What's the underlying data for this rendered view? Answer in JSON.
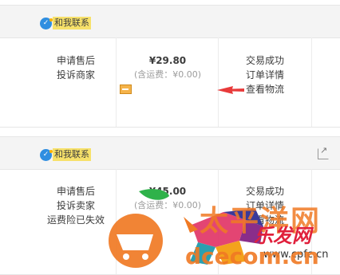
{
  "orders": [
    {
      "contact_label": "和我联系",
      "service": [
        "申请售后",
        "投诉商家"
      ],
      "price": "¥29.80",
      "shipping": "(含运费：¥0.00)",
      "status": [
        "交易成功",
        "订单详情",
        "查看物流"
      ]
    },
    {
      "contact_label": "和我联系",
      "service": [
        "申请售后",
        "投诉卖家",
        "运费险已失效"
      ],
      "price": "¥45.00",
      "shipping": "(含运费：¥0.00)",
      "status": [
        "交易成功",
        "订单详情",
        "查看物流"
      ]
    }
  ],
  "watermark": {
    "text_top": "太平洋网",
    "text_mid": "乐发网",
    "url": "www.cpfc.cn",
    "domain": "dcecom.cn"
  },
  "colors": {
    "accent_arrow": "#e83a3a",
    "contact_bg": "#f7e16a",
    "header_bg": "#f4f4f4",
    "watermark_orange": "#f07a24"
  }
}
